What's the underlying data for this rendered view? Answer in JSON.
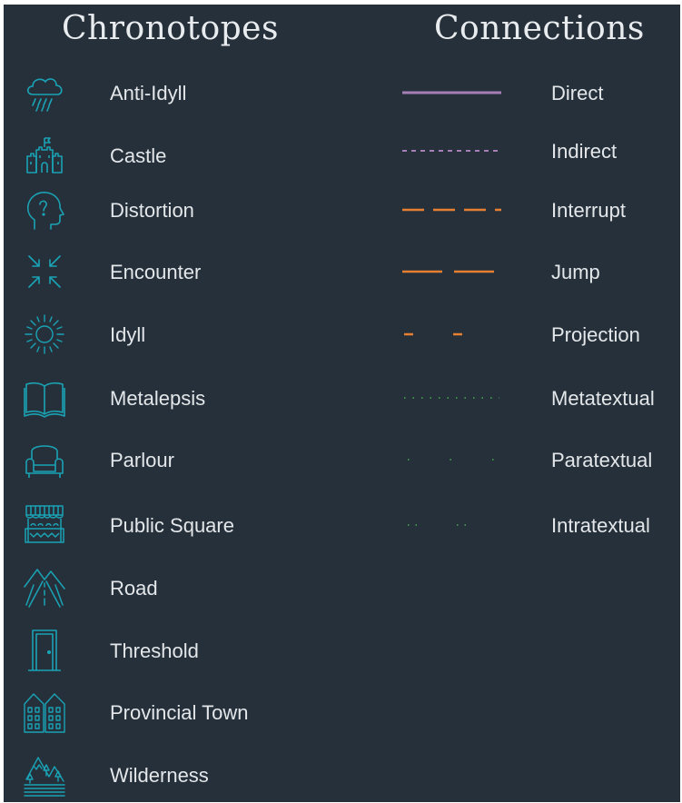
{
  "headings": {
    "chronotopes": "Chronotopes",
    "connections": "Connections"
  },
  "colors": {
    "background": "#26303a",
    "icon": "#1aa3b5",
    "text": "#e3e7ea",
    "purple": "#a67fb6",
    "orange": "#e67f32",
    "green": "#3f9c4a"
  },
  "chronotopes": [
    {
      "label": "Anti-Idyll",
      "icon": "rain-cloud-icon"
    },
    {
      "label": "Castle",
      "icon": "castle-icon"
    },
    {
      "label": "Distortion",
      "icon": "head-question-icon"
    },
    {
      "label": "Encounter",
      "icon": "converging-arrows-icon"
    },
    {
      "label": "Idyll",
      "icon": "sun-icon"
    },
    {
      "label": "Metalepsis",
      "icon": "open-book-icon"
    },
    {
      "label": "Parlour",
      "icon": "armchair-icon"
    },
    {
      "label": "Public Square",
      "icon": "market-stall-icon"
    },
    {
      "label": "Road",
      "icon": "road-icon"
    },
    {
      "label": "Threshold",
      "icon": "door-icon"
    },
    {
      "label": "Provincial Town",
      "icon": "town-houses-icon"
    },
    {
      "label": "Wilderness",
      "icon": "wilderness-icon"
    }
  ],
  "connections": [
    {
      "label": "Direct",
      "style": "solid",
      "color": "#a67fb6"
    },
    {
      "label": "Indirect",
      "style": "short-dash",
      "color": "#a67fb6"
    },
    {
      "label": "Interrupt",
      "style": "long-dash",
      "color": "#e67f32"
    },
    {
      "label": "Jump",
      "style": "two-dash",
      "color": "#e67f32"
    },
    {
      "label": "Projection",
      "style": "sparse-dash",
      "color": "#e67f32"
    },
    {
      "label": "Metatextual",
      "style": "dotted",
      "color": "#3f9c4a"
    },
    {
      "label": "Paratextual",
      "style": "sparse-dot",
      "color": "#3f9c4a"
    },
    {
      "label": "Intratextual",
      "style": "paired-dot",
      "color": "#3f9c4a"
    }
  ]
}
